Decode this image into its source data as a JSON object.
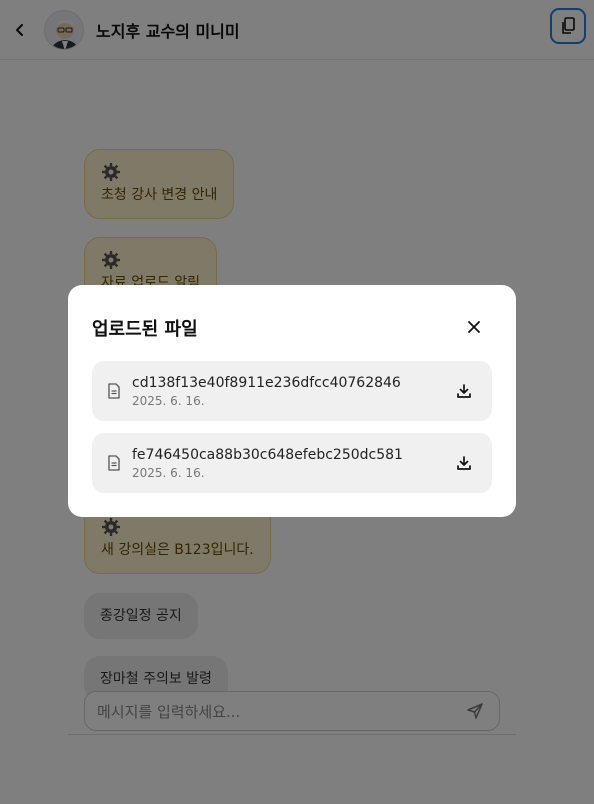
{
  "header": {
    "title": "노지후 교수의 미니미"
  },
  "messages": [
    {
      "text": "초청 강사 변경 안내",
      "kind": "notice"
    },
    {
      "text": "자료 업로드 알림",
      "kind": "notice"
    },
    {
      "text": "새 강의실은 B123입니다.",
      "kind": "notice"
    },
    {
      "text": "종강일정 공지",
      "kind": "plain"
    },
    {
      "text": "장마철 주의보 발령",
      "kind": "plain"
    }
  ],
  "composer": {
    "placeholder": "메시지를 입력하세요..."
  },
  "modal": {
    "title": "업로드된 파일",
    "files": [
      {
        "name": "cd138f13e40f8911e236dfcc40762846",
        "date": "2025. 6. 16."
      },
      {
        "name": "fe746450ca88b30c648efebc250dc581",
        "date": "2025. 6. 16."
      }
    ]
  },
  "colors": {
    "notice_bg": "#fff3cf",
    "notice_border": "#f3d68a",
    "accent": "#2b7fd6"
  },
  "icons": [
    "back-icon",
    "avatar",
    "copy-icon",
    "gear-icon",
    "send-icon",
    "close-icon",
    "file-icon",
    "download-icon"
  ]
}
